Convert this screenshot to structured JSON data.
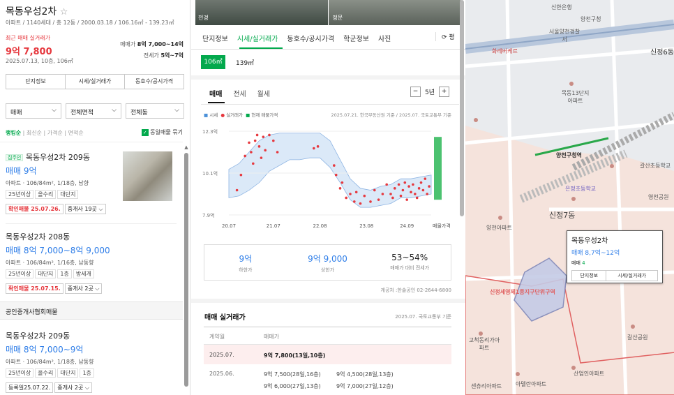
{
  "complex": {
    "name": "목동우성2차",
    "star": "☆",
    "info": "아파트 / 1140세대 / 총 12동 / 2000.03.18 / 106.16㎡ - 139.23㎡",
    "recent_label": "최근 매매 실거래가",
    "recent_price": "9억 7,800",
    "recent_date": "2025.07.13, 10층, 106㎡",
    "sale_label": "매매가",
    "sale_range": "8억 7,000~14억",
    "jeonse_label": "전세가",
    "jeonse_range": "5억~7억"
  },
  "left_buttons": [
    "단지정보",
    "시세/실거래가",
    "동호수/공시가격"
  ],
  "filters": {
    "trade": "매매",
    "area": "전체면적",
    "dong": "전체동"
  },
  "sort": {
    "items": [
      "랭킹순",
      "최신순",
      "가격순",
      "면적순"
    ],
    "same_listing": "동일매물 묶기"
  },
  "listings": [
    {
      "badge": "집주인",
      "title": "목동우성2차 209동",
      "price": "매매 9억",
      "detail": "아파트 · 106/84m², 1/18층, 남향",
      "chips": [
        "25년이상",
        "올수리",
        "대단지"
      ],
      "confirm": "확인매물 25.07.26.",
      "agent": "중개사 19곳"
    },
    {
      "title": "목동우성2차 208동",
      "price": "매매 8억 7,000~8억 9,000",
      "detail": "아파트 · 106/84m², 1/16층, 남동향",
      "chips": [
        "25년이상",
        "대단지",
        "1층",
        "방세개"
      ],
      "confirm": "확인매물 25.07.15.",
      "agent": "중개사 2곳"
    },
    {
      "title": "목동우성2차 209동",
      "price": "매매 8억 7,000~9억",
      "detail": "아파트 · 106/84m², 1/18층, 남동향",
      "chips": [
        "25년이상",
        "올수리",
        "대단지",
        "1층"
      ],
      "confirm": "등록일25.07.22.",
      "agent": "중개사 2곳"
    }
  ],
  "assoc_header": "공인중개사협회매물",
  "photos": [
    "전경",
    "정문"
  ],
  "mid_tabs": [
    "단지정보",
    "시세/실거래가",
    "동호수/공시가격",
    "학군정보",
    "사진"
  ],
  "pyeong": "평",
  "areas": [
    "106㎡",
    "139㎡"
  ],
  "trade_tabs": [
    "매매",
    "전세",
    "월세"
  ],
  "period": "5년",
  "legend": {
    "market": "시세",
    "actual": "실거래가",
    "current": "현재 매물가격",
    "source": "2025.07.21. 한국부동산원 기준 / 2025.07. 국토교통부 기준"
  },
  "chart_data": {
    "type": "scatter",
    "x_ticks": [
      "20.07",
      "21.07",
      "22.08",
      "23.08",
      "24.09"
    ],
    "x_end_label": "매물가격",
    "y_ticks": [
      "12.3억",
      "10.1억",
      "7.9억"
    ],
    "ylim": [
      7.9,
      12.3
    ],
    "band": {
      "x": [
        0,
        0.05,
        0.1,
        0.15,
        0.2,
        0.25,
        0.3,
        0.35,
        0.4,
        0.45,
        0.5,
        0.55,
        0.6,
        0.65,
        0.7,
        0.75,
        0.8,
        0.85,
        0.9,
        0.95,
        1.0
      ],
      "low": [
        8.8,
        8.9,
        9.2,
        9.6,
        10.2,
        10.5,
        10.8,
        10.8,
        10.9,
        10.9,
        10.4,
        9.6,
        8.7,
        8.3,
        8.3,
        8.4,
        8.5,
        8.8,
        8.8,
        8.9,
        9.0
      ],
      "high": [
        10.3,
        10.6,
        11.2,
        11.8,
        12.1,
        12.2,
        12.2,
        12.2,
        12.2,
        12.2,
        11.8,
        10.8,
        9.8,
        9.3,
        9.2,
        9.4,
        9.5,
        9.8,
        9.8,
        9.9,
        10.0
      ]
    },
    "points": [
      [
        0.04,
        9.2
      ],
      [
        0.06,
        10.0
      ],
      [
        0.08,
        11.0
      ],
      [
        0.1,
        11.7
      ],
      [
        0.11,
        11.2
      ],
      [
        0.12,
        10.6
      ],
      [
        0.13,
        11.8
      ],
      [
        0.14,
        12.1
      ],
      [
        0.15,
        11.5
      ],
      [
        0.16,
        10.9
      ],
      [
        0.17,
        12.0
      ],
      [
        0.18,
        11.3
      ],
      [
        0.2,
        12.1
      ],
      [
        0.22,
        11.8
      ],
      [
        0.24,
        11.2
      ],
      [
        0.42,
        11.4
      ],
      [
        0.44,
        11.5
      ],
      [
        0.52,
        10.5
      ],
      [
        0.53,
        10.0
      ],
      [
        0.55,
        9.3
      ],
      [
        0.56,
        9.6
      ],
      [
        0.58,
        8.8
      ],
      [
        0.6,
        9.0
      ],
      [
        0.62,
        8.6
      ],
      [
        0.63,
        9.1
      ],
      [
        0.65,
        8.5
      ],
      [
        0.67,
        8.9
      ],
      [
        0.7,
        8.6
      ],
      [
        0.72,
        9.2
      ],
      [
        0.74,
        8.7
      ],
      [
        0.76,
        9.0
      ],
      [
        0.78,
        9.5
      ],
      [
        0.8,
        9.0
      ],
      [
        0.81,
        8.8
      ],
      [
        0.82,
        9.3
      ],
      [
        0.84,
        9.5
      ],
      [
        0.85,
        8.9
      ],
      [
        0.86,
        9.2
      ],
      [
        0.87,
        9.6
      ],
      [
        0.88,
        8.7
      ],
      [
        0.89,
        9.4
      ],
      [
        0.9,
        9.1
      ],
      [
        0.91,
        9.5
      ],
      [
        0.92,
        9.0
      ],
      [
        0.93,
        8.8
      ],
      [
        0.94,
        9.3
      ],
      [
        0.95,
        9.6
      ],
      [
        0.96,
        9.2
      ],
      [
        0.97,
        9.8
      ],
      [
        0.98,
        9.0
      ],
      [
        0.99,
        9.4
      ]
    ],
    "current_range": [
      8.7,
      12.0
    ]
  },
  "stats": [
    {
      "v": "9억",
      "l": "하한가"
    },
    {
      "v": "9억 9,000",
      "l": "상한가"
    },
    {
      "v": "53~54%",
      "l": "매매가 대비 전세가"
    }
  ],
  "provider": "게공처 :한솔공인 02-2644-6800",
  "trades": {
    "title": "매매 실거래가",
    "basis": "2025.07. 국토교통부 기준",
    "col1": "계약월",
    "col2": "매매가",
    "rows": [
      {
        "m": "2025.07.",
        "p": [
          "9억 7,800(13일,10층)"
        ],
        "hl": true
      },
      {
        "m": "2025.06.",
        "p": [
          "9억 7,500(28일,16층)",
          "9억 4,500(28일,13층)",
          "9억 6,000(27일,13층)",
          "9억 7,000(27일,12층)"
        ]
      }
    ]
  },
  "map": {
    "labels": [
      "신한은행",
      "양천구청",
      "서울양천경찰서",
      "화레버케르",
      "신정6동",
      "목동13단지아파트",
      "양천구청역",
      "갈산초등학교",
      "은정초등학교",
      "신정7동",
      "양천아파트",
      "영천공원",
      "고척동리가아파트",
      "신정세영제1종지구단위구역",
      "갈산공원",
      "센츄리아파트",
      "아델란아파트",
      "산업인아파트"
    ],
    "popup": {
      "name": "목동우성2차",
      "price": "매매 8,7억~12억",
      "count_label": "매매",
      "count": "4",
      "btn1": "단지정보",
      "btn2": "시세/실거래가"
    }
  }
}
